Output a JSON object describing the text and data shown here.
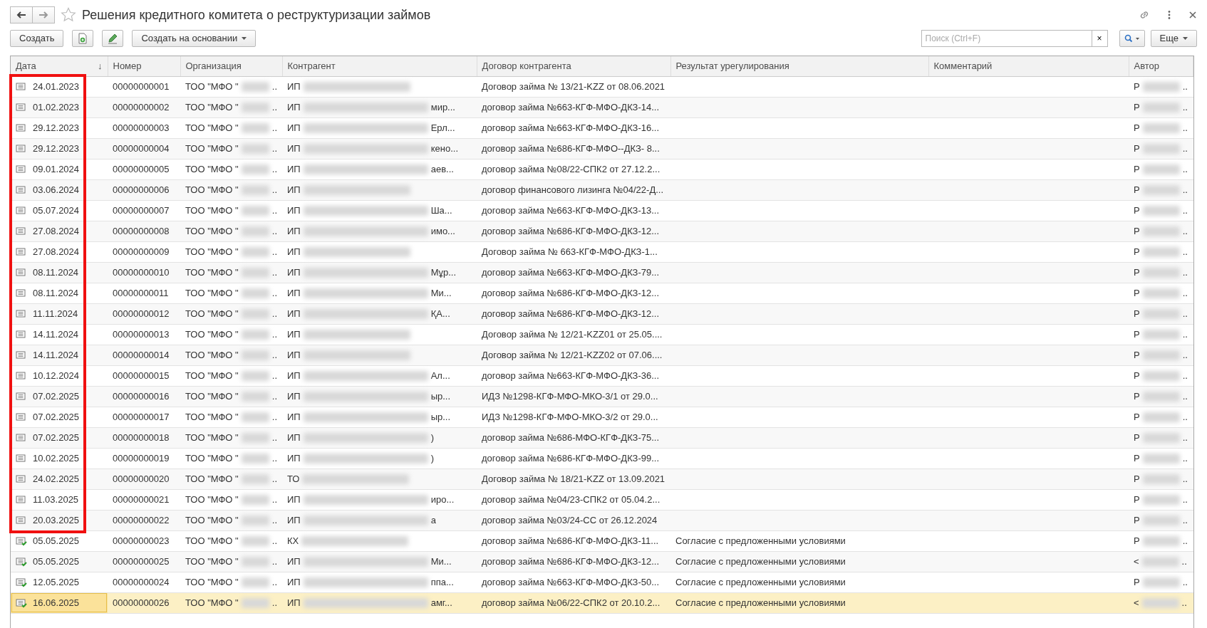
{
  "window": {
    "title": "Решения кредитного комитета о реструктуризации займов",
    "favorite": false
  },
  "toolbar": {
    "create": "Создать",
    "create_based_on": "Создать на основании",
    "search_placeholder": "Поиск (Ctrl+F)",
    "clear": "×",
    "more": "Еще"
  },
  "table": {
    "columns": [
      {
        "label": "Дата",
        "sort_mark": "↓"
      },
      {
        "label": "Номер"
      },
      {
        "label": "Организация"
      },
      {
        "label": "Контрагент"
      },
      {
        "label": "Договор контрагента"
      },
      {
        "label": "Результат урегулирования"
      },
      {
        "label": "Комментарий"
      },
      {
        "label": "Автор"
      }
    ],
    "rows": [
      {
        "date": "24.01.2023",
        "number": "00000000001",
        "org": "ТОО \"МФО \"",
        "org_tail": "..",
        "contractor": "ИП",
        "contractor_tail": "",
        "contract": "Договор займа № 13/21-KZZ от 08.06.2021",
        "result": "",
        "author": "Р",
        "author_tail": "..",
        "approved": false,
        "marked": true,
        "selected": false
      },
      {
        "date": "01.02.2023",
        "number": "00000000002",
        "org": "ТОО \"МФО \"",
        "org_tail": "..",
        "contractor": "ИП",
        "contractor_tail": "мир...",
        "contract": "договор займа №663-КГФ-МФО-ДКЗ-14...",
        "result": "",
        "author": "Р",
        "author_tail": "..",
        "approved": false,
        "marked": true,
        "selected": false
      },
      {
        "date": "29.12.2023",
        "number": "00000000003",
        "org": "ТОО \"МФО \"",
        "org_tail": "..",
        "contractor": "ИП",
        "contractor_tail": "Ерл...",
        "contract": "договор займа №663-КГФ-МФО-ДКЗ-16...",
        "result": "",
        "author": "Р",
        "author_tail": "..",
        "approved": false,
        "marked": true,
        "selected": false
      },
      {
        "date": "29.12.2023",
        "number": "00000000004",
        "org": "ТОО \"МФО \"",
        "org_tail": "..",
        "contractor": "ИП",
        "contractor_tail": "кено...",
        "contract": "договор займа №686-КГФ-МФО--ДКЗ- 8...",
        "result": "",
        "author": "Р",
        "author_tail": "..",
        "approved": false,
        "marked": true,
        "selected": false
      },
      {
        "date": "09.01.2024",
        "number": "00000000005",
        "org": "ТОО \"МФО \"",
        "org_tail": "..",
        "contractor": "ИП",
        "contractor_tail": "аев...",
        "contract": "договор займа №08/22-СПК2 от 27.12.2...",
        "result": "",
        "author": "Р",
        "author_tail": "..",
        "approved": false,
        "marked": true,
        "selected": false
      },
      {
        "date": "03.06.2024",
        "number": "00000000006",
        "org": "ТОО \"МФО \"",
        "org_tail": "..",
        "contractor": "ИП",
        "contractor_tail": "",
        "contract": "договор финансового лизинга №04/22-Д...",
        "result": "",
        "author": "Р",
        "author_tail": "..",
        "approved": false,
        "marked": true,
        "selected": false
      },
      {
        "date": "05.07.2024",
        "number": "00000000007",
        "org": "ТОО \"МФО \"",
        "org_tail": "..",
        "contractor": "ИП",
        "contractor_tail": "Ша...",
        "contract": "договор займа №663-КГФ-МФО-ДКЗ-13...",
        "result": "",
        "author": "Р",
        "author_tail": "..",
        "approved": false,
        "marked": true,
        "selected": false
      },
      {
        "date": "27.08.2024",
        "number": "00000000008",
        "org": "ТОО \"МФО \"",
        "org_tail": "..",
        "contractor": "ИП",
        "contractor_tail": "имо...",
        "contract": "договор займа №686-КГФ-МФО-ДКЗ-12...",
        "result": "",
        "author": "Р",
        "author_tail": "..",
        "approved": false,
        "marked": true,
        "selected": false
      },
      {
        "date": "27.08.2024",
        "number": "00000000009",
        "org": "ТОО \"МФО \"",
        "org_tail": "..",
        "contractor": "ИП",
        "contractor_tail": "",
        "contract": "Договор займа № 663-КГФ-МФО-ДКЗ-1...",
        "result": "",
        "author": "Р",
        "author_tail": "..",
        "approved": false,
        "marked": true,
        "selected": false
      },
      {
        "date": "08.11.2024",
        "number": "00000000010",
        "org": "ТОО \"МФО \"",
        "org_tail": "..",
        "contractor": "ИП",
        "contractor_tail": "Мұр...",
        "contract": "договор займа №663-КГФ-МФО-ДКЗ-79...",
        "result": "",
        "author": "Р",
        "author_tail": "..",
        "approved": false,
        "marked": true,
        "selected": false
      },
      {
        "date": "08.11.2024",
        "number": "00000000011",
        "org": "ТОО \"МФО \"",
        "org_tail": "..",
        "contractor": "ИП",
        "contractor_tail": "Ми...",
        "contract": "договор займа №686-КГФ-МФО-ДКЗ-12...",
        "result": "",
        "author": "Р",
        "author_tail": "..",
        "approved": false,
        "marked": true,
        "selected": false
      },
      {
        "date": "11.11.2024",
        "number": "00000000012",
        "org": "ТОО \"МФО \"",
        "org_tail": "..",
        "contractor": "ИП",
        "contractor_tail": "ҚА...",
        "contract": "договор займа №686-КГФ-МФО-ДКЗ-12...",
        "result": "",
        "author": "Р",
        "author_tail": "..",
        "approved": false,
        "marked": true,
        "selected": false
      },
      {
        "date": "14.11.2024",
        "number": "00000000013",
        "org": "ТОО \"МФО \"",
        "org_tail": "..",
        "contractor": "ИП",
        "contractor_tail": "",
        "contract": "Договор займа № 12/21-KZZ01 от 25.05....",
        "result": "",
        "author": "Р",
        "author_tail": "..",
        "approved": false,
        "marked": true,
        "selected": false
      },
      {
        "date": "14.11.2024",
        "number": "00000000014",
        "org": "ТОО \"МФО \"",
        "org_tail": "..",
        "contractor": "ИП",
        "contractor_tail": "",
        "contract": "Договор займа № 12/21-KZZ02 от 07.06....",
        "result": "",
        "author": "Р",
        "author_tail": "..",
        "approved": false,
        "marked": true,
        "selected": false
      },
      {
        "date": "10.12.2024",
        "number": "00000000015",
        "org": "ТОО \"МФО \"",
        "org_tail": "..",
        "contractor": "ИП",
        "contractor_tail": "Ал...",
        "contract": "договор займа №663-КГФ-МФО-ДКЗ-36...",
        "result": "",
        "author": "Р",
        "author_tail": "..",
        "approved": false,
        "marked": true,
        "selected": false
      },
      {
        "date": "07.02.2025",
        "number": "00000000016",
        "org": "ТОО \"МФО \"",
        "org_tail": "..",
        "contractor": "ИП",
        "contractor_tail": "ыр...",
        "contract": "ИДЗ №1298-КГФ-МФО-МКО-3/1 от 29.0...",
        "result": "",
        "author": "Р",
        "author_tail": "..",
        "approved": false,
        "marked": true,
        "selected": false
      },
      {
        "date": "07.02.2025",
        "number": "00000000017",
        "org": "ТОО \"МФО \"",
        "org_tail": "..",
        "contractor": "ИП",
        "contractor_tail": "ыр...",
        "contract": "ИДЗ №1298-КГФ-МФО-МКО-3/2 от 29.0...",
        "result": "",
        "author": "Р",
        "author_tail": "..",
        "approved": false,
        "marked": true,
        "selected": false
      },
      {
        "date": "07.02.2025",
        "number": "00000000018",
        "org": "ТОО \"МФО \"",
        "org_tail": "..",
        "contractor": "ИП",
        "contractor_tail": ")",
        "contract": "договор займа №686-МФО-КГФ-ДКЗ-75...",
        "result": "",
        "author": "Р",
        "author_tail": "..",
        "approved": false,
        "marked": true,
        "selected": false
      },
      {
        "date": "10.02.2025",
        "number": "00000000019",
        "org": "ТОО \"МФО \"",
        "org_tail": "..",
        "contractor": "ИП",
        "contractor_tail": ")",
        "contract": "договор займа №686-КГФ-МФО-ДКЗ-99...",
        "result": "",
        "author": "Р",
        "author_tail": "..",
        "approved": false,
        "marked": true,
        "selected": false
      },
      {
        "date": "24.02.2025",
        "number": "00000000020",
        "org": "ТОО \"МФО \"",
        "org_tail": "..",
        "contractor": "ТО",
        "contractor_tail": "",
        "contract": "Договор займа № 18/21-KZZ от 13.09.2021",
        "result": "",
        "author": "Р",
        "author_tail": "..",
        "approved": false,
        "marked": true,
        "selected": false
      },
      {
        "date": "11.03.2025",
        "number": "00000000021",
        "org": "ТОО \"МФО \"",
        "org_tail": "..",
        "contractor": "ИП",
        "contractor_tail": "иро...",
        "contract": "договор займа №04/23-СПК2 от 05.04.2...",
        "result": "",
        "author": "Р",
        "author_tail": "..",
        "approved": false,
        "marked": true,
        "selected": false
      },
      {
        "date": "20.03.2025",
        "number": "00000000022",
        "org": "ТОО \"МФО \"",
        "org_tail": "..",
        "contractor": "ИП",
        "contractor_tail": "а",
        "contract": "договор займа №03/24-СС от 26.12.2024",
        "result": "",
        "author": "Р",
        "author_tail": "..",
        "approved": false,
        "marked": true,
        "selected": false
      },
      {
        "date": "05.05.2025",
        "number": "00000000023",
        "org": "ТОО \"МФО \"",
        "org_tail": "..",
        "contractor": "КХ",
        "contractor_tail": "",
        "contract": "договор займа №686-КГФ-МФО-ДКЗ-11...",
        "result": "Согласие с предложенными условиями",
        "author": "Р",
        "author_tail": "..",
        "approved": true,
        "marked": false,
        "selected": false
      },
      {
        "date": "05.05.2025",
        "number": "00000000025",
        "org": "ТОО \"МФО \"",
        "org_tail": "..",
        "contractor": "ИП",
        "contractor_tail": "Ми...",
        "contract": "договор займа №686-КГФ-МФО-ДКЗ-12...",
        "result": "Согласие с предложенными условиями",
        "author": "<",
        "author_tail": "..",
        "approved": true,
        "marked": false,
        "selected": false
      },
      {
        "date": "12.05.2025",
        "number": "00000000024",
        "org": "ТОО \"МФО \"",
        "org_tail": "..",
        "contractor": "ИП",
        "contractor_tail": "ппа...",
        "contract": "договор займа №663-КГФ-МФО-ДКЗ-50...",
        "result": "Согласие с предложенными условиями",
        "author": "Р",
        "author_tail": "..",
        "approved": true,
        "marked": false,
        "selected": false
      },
      {
        "date": "16.06.2025",
        "number": "00000000026",
        "org": "ТОО \"МФО \"",
        "org_tail": "..",
        "contractor": "ИП",
        "contractor_tail": "амг...",
        "contract": "договор займа №06/22-СПК2 от 20.10.2...",
        "result": "Согласие с предложенными условиями",
        "author": "<",
        "author_tail": "..",
        "approved": true,
        "marked": false,
        "selected": true
      }
    ]
  }
}
